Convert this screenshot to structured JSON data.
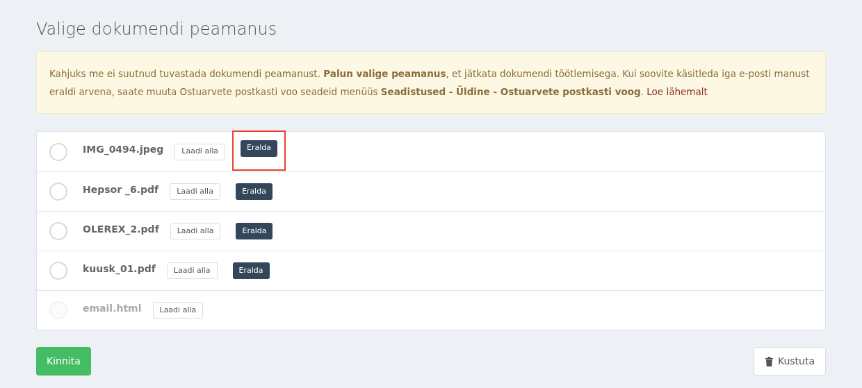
{
  "title": "Valige dokumendi peamanus",
  "notice": {
    "text": "Kahjuks me ei suutnud tuvastada dokumendi peamanust. **Palun valige peamanus**, et jätkata dokumendi töötlemisega. Kui soovite käsitleda iga e-posti manust eraldi arvena, saate muuta Ostuarvete postkasti voo seadeid menüüs **Seadistused - Üldine - Ostuarvete postkasti voog**.",
    "link": "Loe lähemalt"
  },
  "files": [
    {
      "name": "IMG_0494.jpeg",
      "selected": false,
      "disabled": false,
      "download": "Laadi alla",
      "split": "Eralda",
      "highlighted": true
    },
    {
      "name": "Hepsor _6.pdf",
      "selected": false,
      "disabled": false,
      "download": "Laadi alla",
      "split": "Eralda"
    },
    {
      "name": "OLEREX_2.pdf",
      "selected": false,
      "disabled": false,
      "download": "Laadi alla",
      "split": "Eralda"
    },
    {
      "name": "kuusk_01.pdf",
      "selected": false,
      "disabled": false,
      "download": "Laadi alla",
      "split": "Eralda"
    },
    {
      "name": "email.html",
      "selected": false,
      "disabled": true,
      "download": "Laadi alla"
    }
  ],
  "confirm": "Kinnita",
  "delete": "Kustuta"
}
